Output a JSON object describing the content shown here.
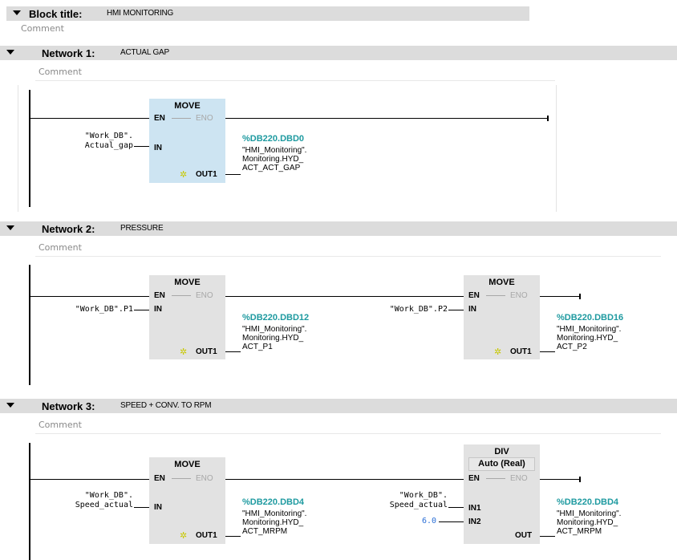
{
  "block": {
    "label": "Block title:",
    "title": "HMI MONITORING",
    "comment": "Comment"
  },
  "networks": [
    {
      "label": "Network 1:",
      "title": "ACTUAL GAP",
      "comment": "Comment",
      "boxes": [
        {
          "name": "MOVE",
          "en": "EN",
          "eno": "ENO",
          "in": "IN",
          "out": "OUT1",
          "input_var": [
            "\"Work_DB\".",
            "Actual_gap"
          ],
          "output_addr": "%DB220.DBD0",
          "output_var": [
            "\"HMI_Monitoring\".",
            "Monitoring.HYD_",
            "ACT_ACT_GAP"
          ]
        }
      ]
    },
    {
      "label": "Network 2:",
      "title": "PRESSURE",
      "comment": "Comment",
      "boxes": [
        {
          "name": "MOVE",
          "en": "EN",
          "eno": "ENO",
          "in": "IN",
          "out": "OUT1",
          "input_var": "\"Work_DB\".P1",
          "output_addr": "%DB220.DBD12",
          "output_var": [
            "\"HMI_Monitoring\".",
            "Monitoring.HYD_",
            "ACT_P1"
          ]
        },
        {
          "name": "MOVE",
          "en": "EN",
          "eno": "ENO",
          "in": "IN",
          "out": "OUT1",
          "input_var": "\"Work_DB\".P2",
          "output_addr": "%DB220.DBD16",
          "output_var": [
            "\"HMI_Monitoring\".",
            "Monitoring.HYD_",
            "ACT_P2"
          ]
        }
      ]
    },
    {
      "label": "Network 3:",
      "title": "SPEED + CONV. TO RPM",
      "comment": "Comment",
      "boxes": [
        {
          "name": "MOVE",
          "en": "EN",
          "eno": "ENO",
          "in": "IN",
          "out": "OUT1",
          "input_var": [
            "\"Work_DB\".",
            "Speed_actual"
          ],
          "output_addr": "%DB220.DBD4",
          "output_var": [
            "\"HMI_Monitoring\".",
            "Monitoring.HYD_",
            "ACT_MRPM"
          ]
        },
        {
          "name": "DIV",
          "subtitle": "Auto (Real)",
          "en": "EN",
          "eno": "ENO",
          "in1": "IN1",
          "in2": "IN2",
          "out": "OUT",
          "input_var": [
            "\"Work_DB\".",
            "Speed_actual"
          ],
          "input2_value": "6.0",
          "output_addr": "%DB220.DBD4",
          "output_var": [
            "\"HMI_Monitoring\".",
            "Monitoring.HYD_",
            "ACT_MRPM"
          ]
        }
      ]
    }
  ],
  "icons": {
    "collapse": "triangle-down-icon",
    "new-output": "sparkle-icon"
  },
  "colors": {
    "header": "#dcdcdc",
    "box": "#e2e2e2",
    "box_selected": "#cde4f2",
    "address": "#1e9aa0",
    "constant": "#2b6fd6"
  }
}
